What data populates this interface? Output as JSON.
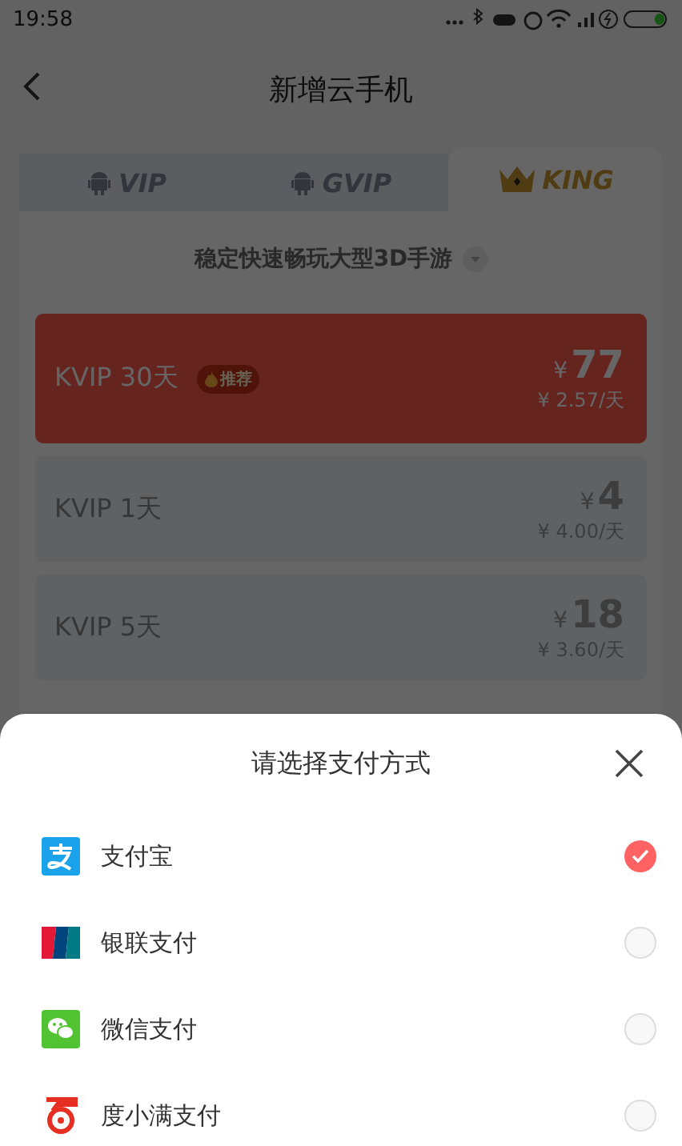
{
  "status_bar": {
    "time": "19:58"
  },
  "header": {
    "title": "新增云手机"
  },
  "tabs": [
    {
      "label": "VIP",
      "kind": "android",
      "selected": false
    },
    {
      "label": "GVIP",
      "kind": "android",
      "selected": false
    },
    {
      "label": "KING",
      "kind": "crown",
      "selected": true
    }
  ],
  "subtitle": "稳定快速畅玩大型3D手游",
  "plans": [
    {
      "name": "KVIP 30天",
      "badge": "推荐",
      "currency": "¥",
      "price": "77",
      "per_day": "¥ 2.57/天",
      "selected": true
    },
    {
      "name": "KVIP 1天",
      "currency": "¥",
      "price": "4",
      "per_day": "¥ 4.00/天",
      "selected": false
    },
    {
      "name": "KVIP 5天",
      "currency": "¥",
      "price": "18",
      "per_day": "¥ 3.60/天",
      "selected": false
    }
  ],
  "payment_sheet": {
    "title": "请选择支付方式",
    "methods": [
      {
        "name": "支付宝",
        "kind": "alipay",
        "selected": true
      },
      {
        "name": "银联支付",
        "kind": "unionpay",
        "selected": false
      },
      {
        "name": "微信支付",
        "kind": "wechat",
        "selected": false
      },
      {
        "name": "度小满支付",
        "kind": "duxiaoman",
        "selected": false
      }
    ]
  }
}
